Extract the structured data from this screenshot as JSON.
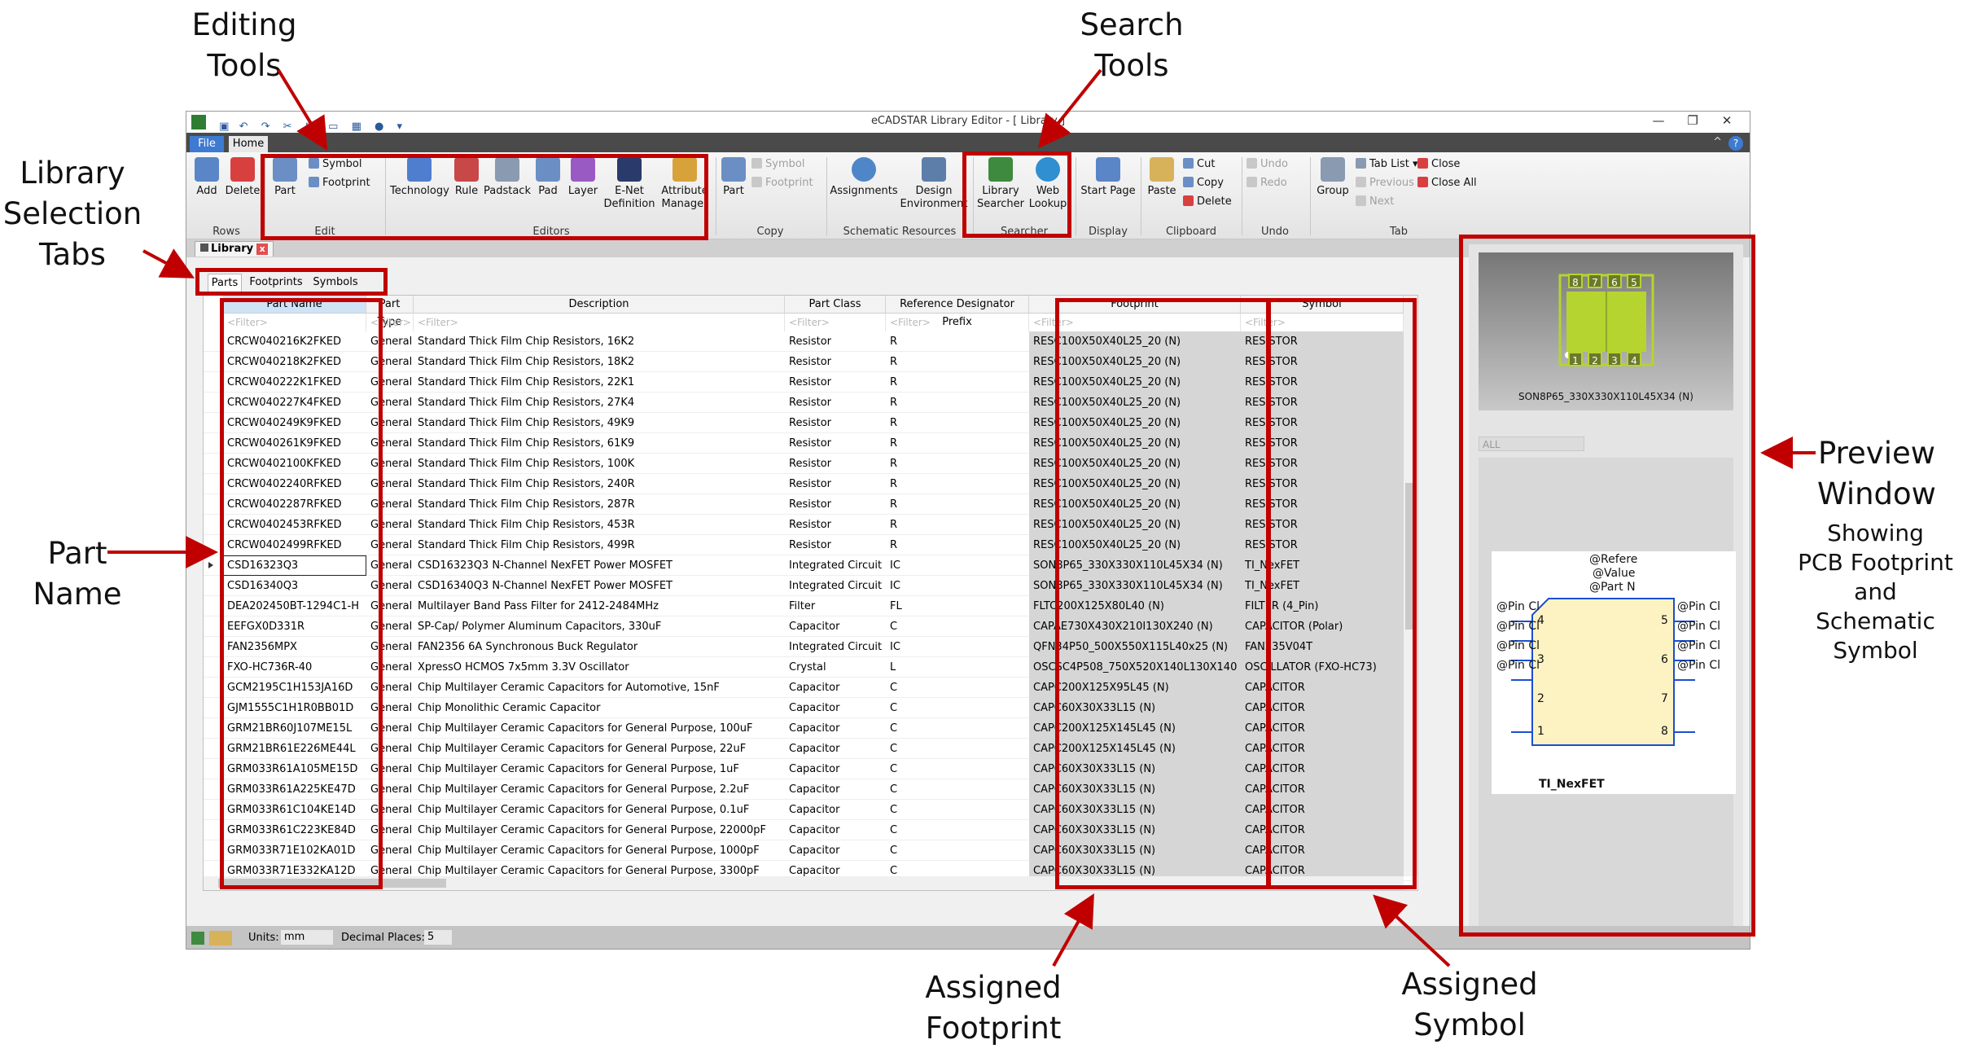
{
  "annotations": {
    "editing_tools": [
      "Editing",
      "Tools"
    ],
    "search_tools": [
      "Search",
      "Tools"
    ],
    "library_selection_tabs": [
      "Library",
      "Selection",
      "Tabs"
    ],
    "part_name": [
      "Part",
      "Name"
    ],
    "preview_window": [
      "Preview",
      "Window"
    ],
    "preview_sub": [
      "Showing",
      "PCB Footprint",
      "and",
      "Schematic Symbol"
    ],
    "assigned_footprint": [
      "Assigned",
      "Footprint"
    ],
    "assigned_symbol": [
      "Assigned",
      "Symbol"
    ]
  },
  "window": {
    "title": "eCADSTAR Library Editor - [ Library ]",
    "controls": {
      "minimize": "—",
      "restore": "❐",
      "close": "✕"
    },
    "ribbon_tabs": {
      "file": "File",
      "home": "Home"
    },
    "help": "?",
    "collapse": "^"
  },
  "ribbon": {
    "rows": {
      "add": "Add",
      "delete": "Delete",
      "group": "Rows"
    },
    "edit": {
      "part": "Part",
      "symbol": "Symbol",
      "footprint": "Footprint",
      "group": "Edit"
    },
    "editors": {
      "technology": "Technology",
      "rule": "Rule",
      "padstack": "Padstack",
      "pad": "Pad",
      "layer": "Layer",
      "enet1": "E-Net",
      "enet2": "Definition",
      "attr1": "Attribute",
      "attr2": "Manager",
      "group": "Editors"
    },
    "copy": {
      "part": "Part",
      "symbol": "Symbol",
      "footprint": "Footprint",
      "group": "Copy"
    },
    "schematic": {
      "assignments": "Assignments",
      "design1": "Design",
      "design2": "Environment",
      "group": "Schematic Resources"
    },
    "searcher": {
      "lib1": "Library",
      "lib2": "Searcher",
      "web1": "Web",
      "web2": "Lookup",
      "group": "Searcher"
    },
    "display": {
      "start": "Start Page",
      "group": "Display"
    },
    "clipboard": {
      "paste": "Paste",
      "cut": "Cut",
      "copy": "Copy",
      "delete": "Delete",
      "group": "Clipboard"
    },
    "undo": {
      "undo": "Undo",
      "redo": "Redo",
      "group": "Undo"
    },
    "tab": {
      "group_btn": "Group",
      "tablist": "Tab List",
      "previous": "Previous",
      "next": "Next",
      "close": "Close",
      "closeall": "Close All",
      "group": "Tab"
    }
  },
  "doc_tab": {
    "label": "Library",
    "close": "x"
  },
  "library_tabs": [
    "Parts",
    "Footprints",
    "Symbols"
  ],
  "grid": {
    "columns": [
      "Part Name",
      "Part Type",
      "Description",
      "Part Class",
      "Reference Designator Prefix",
      "Footprint",
      "Symbol"
    ],
    "filter_placeholder": "<Filter>",
    "rows": [
      [
        "CRCW040216K2FKED",
        "General",
        "Standard Thick Film Chip Resistors, 16K2",
        "Resistor",
        "R",
        "RESC100X50X40L25_20 (N)",
        "RESISTOR"
      ],
      [
        "CRCW040218K2FKED",
        "General",
        "Standard Thick Film Chip Resistors, 18K2",
        "Resistor",
        "R",
        "RESC100X50X40L25_20 (N)",
        "RESISTOR"
      ],
      [
        "CRCW040222K1FKED",
        "General",
        "Standard Thick Film Chip Resistors, 22K1",
        "Resistor",
        "R",
        "RESC100X50X40L25_20 (N)",
        "RESISTOR"
      ],
      [
        "CRCW040227K4FKED",
        "General",
        "Standard Thick Film Chip Resistors, 27K4",
        "Resistor",
        "R",
        "RESC100X50X40L25_20 (N)",
        "RESISTOR"
      ],
      [
        "CRCW040249K9FKED",
        "General",
        "Standard Thick Film Chip Resistors, 49K9",
        "Resistor",
        "R",
        "RESC100X50X40L25_20 (N)",
        "RESISTOR"
      ],
      [
        "CRCW040261K9FKED",
        "General",
        "Standard Thick Film Chip Resistors, 61K9",
        "Resistor",
        "R",
        "RESC100X50X40L25_20 (N)",
        "RESISTOR"
      ],
      [
        "CRCW0402100KFKED",
        "General",
        "Standard Thick Film Chip Resistors, 100K",
        "Resistor",
        "R",
        "RESC100X50X40L25_20 (N)",
        "RESISTOR"
      ],
      [
        "CRCW0402240RFKED",
        "General",
        "Standard Thick Film Chip Resistors, 240R",
        "Resistor",
        "R",
        "RESC100X50X40L25_20 (N)",
        "RESISTOR"
      ],
      [
        "CRCW0402287RFKED",
        "General",
        "Standard Thick Film Chip Resistors, 287R",
        "Resistor",
        "R",
        "RESC100X50X40L25_20 (N)",
        "RESISTOR"
      ],
      [
        "CRCW0402453RFKED",
        "General",
        "Standard Thick Film Chip Resistors, 453R",
        "Resistor",
        "R",
        "RESC100X50X40L25_20 (N)",
        "RESISTOR"
      ],
      [
        "CRCW0402499RFKED",
        "General",
        "Standard Thick Film Chip Resistors, 499R",
        "Resistor",
        "R",
        "RESC100X50X40L25_20 (N)",
        "RESISTOR"
      ],
      [
        "CSD16323Q3",
        "General",
        "CSD16323Q3 N-Channel NexFET Power MOSFET",
        "Integrated Circuit",
        "IC",
        "SON8P65_330X330X110L45X34 (N)",
        "TI_NexFET"
      ],
      [
        "CSD16340Q3",
        "General",
        "CSD16340Q3 N-Channel NexFET Power MOSFET",
        "Integrated Circuit",
        "IC",
        "SON8P65_330X330X110L45X34 (N)",
        "TI_NexFET"
      ],
      [
        "DEA202450BT-1294C1-H",
        "General",
        "Multilayer Band Pass Filter for 2412-2484MHz",
        "Filter",
        "FL",
        "FLTC200X125X80L40 (N)",
        "FILTER (4_Pin)"
      ],
      [
        "EEFGX0D331R",
        "General",
        "SP-Cap/ Polymer Aluminum Capacitors, 330uF",
        "Capacitor",
        "C",
        "CAPAE730X430X210I130X240 (N)",
        "CAPACITOR (Polar)"
      ],
      [
        "FAN2356MPX",
        "General",
        "FAN2356 6A Synchronous Buck Regulator",
        "Integrated Circuit",
        "IC",
        "QFN34P50_500X550X115L40x25 (N)",
        "FAN235V04T"
      ],
      [
        "FXO-HC736R-40",
        "General",
        "XpressO HCMOS 7x5mm 3.3V Oscillator",
        "Crystal",
        "L",
        "OSCSC4P508_750X520X140L130X140 (N)",
        "OSCILLATOR (FXO-HC73)"
      ],
      [
        "GCM2195C1H153JA16D",
        "General",
        "Chip Multilayer Ceramic Capacitors for Automotive, 15nF",
        "Capacitor",
        "C",
        "CAPC200X125X95L45 (N)",
        "CAPACITOR"
      ],
      [
        "GJM1555C1H1R0BB01D",
        "General",
        "Chip Monolithic Ceramic Capacitor",
        "Capacitor",
        "C",
        "CAPC60X30X33L15 (N)",
        "CAPACITOR"
      ],
      [
        "GRM21BR60J107ME15L",
        "General",
        "Chip Multilayer Ceramic Capacitors for General Purpose, 100uF",
        "Capacitor",
        "C",
        "CAPC200X125X145L45 (N)",
        "CAPACITOR"
      ],
      [
        "GRM21BR61E226ME44L",
        "General",
        "Chip Multilayer Ceramic Capacitors for General Purpose, 22uF",
        "Capacitor",
        "C",
        "CAPC200X125X145L45 (N)",
        "CAPACITOR"
      ],
      [
        "GRM033R61A105ME15D",
        "General",
        "Chip Multilayer Ceramic Capacitors for General Purpose, 1uF",
        "Capacitor",
        "C",
        "CAPC60X30X33L15 (N)",
        "CAPACITOR"
      ],
      [
        "GRM033R61A225KE47D",
        "General",
        "Chip Multilayer Ceramic Capacitors for General Purpose, 2.2uF",
        "Capacitor",
        "C",
        "CAPC60X30X33L15 (N)",
        "CAPACITOR"
      ],
      [
        "GRM033R61C104KE14D",
        "General",
        "Chip Multilayer Ceramic Capacitors for General Purpose, 0.1uF",
        "Capacitor",
        "C",
        "CAPC60X30X33L15 (N)",
        "CAPACITOR"
      ],
      [
        "GRM033R61C223KE84D",
        "General",
        "Chip Multilayer Ceramic Capacitors for General Purpose, 22000pF",
        "Capacitor",
        "C",
        "CAPC60X30X33L15 (N)",
        "CAPACITOR"
      ],
      [
        "GRM033R71E102KA01D",
        "General",
        "Chip Multilayer Ceramic Capacitors for General Purpose, 1000pF",
        "Capacitor",
        "C",
        "CAPC60X30X33L15 (N)",
        "CAPACITOR"
      ],
      [
        "GRM033R71E332KA12D",
        "General",
        "Chip Multilayer Ceramic Capacitors for General Purpose, 3300pF",
        "Capacitor",
        "C",
        "CAPC60X30X33L15 (N)",
        "CAPACITOR"
      ]
    ],
    "selected_row": 11
  },
  "preview": {
    "footprint_name": "SON8P65_330X330X110L45X34 (N)",
    "pad_numbers_top": [
      "8",
      "7",
      "6",
      "5"
    ],
    "pad_numbers_bottom": [
      "1",
      "2",
      "3",
      "4"
    ],
    "filter_combo": "ALL",
    "symbol": {
      "ref": "@Refere",
      "value": "@Value",
      "partno": "@Part N",
      "pin_label": "@Pin Cl",
      "pins_left": [
        "4",
        "3",
        "2",
        "1"
      ],
      "pins_right": [
        "5",
        "6",
        "7",
        "8"
      ],
      "name": "TI_NexFET"
    }
  },
  "status_bar": {
    "units_label": "Units:",
    "units_value": "mm",
    "decimal_label": "Decimal Places:",
    "decimal_value": "5"
  },
  "colors": {
    "annotation_red": "#c00000",
    "ribbon_file_blue": "#3e7ad1",
    "pcb_green": "#b5d430"
  }
}
